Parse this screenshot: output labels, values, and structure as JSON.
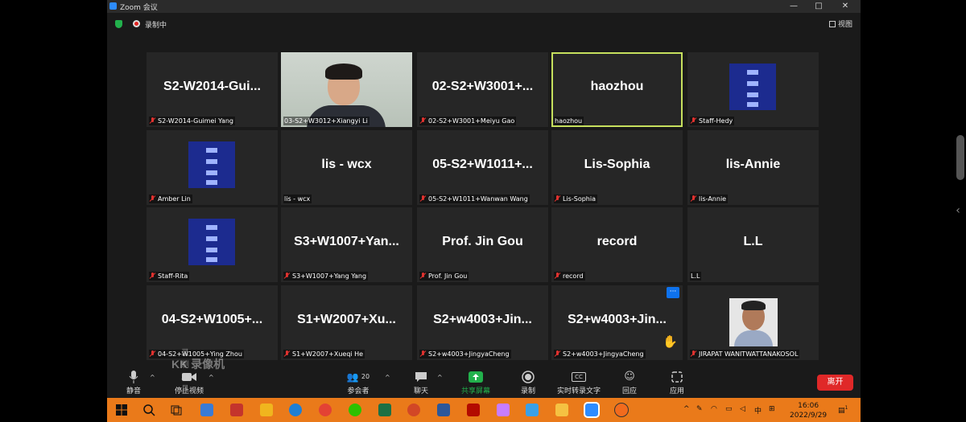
{
  "window": {
    "title": "Zoom 会议",
    "controls": [
      "—",
      "□",
      "✕"
    ]
  },
  "topbar": {
    "recording_label": "录制中",
    "view_label": "视图"
  },
  "tiles": [
    {
      "big": "S2-W2014-Gui...",
      "label": "S2-W2014-Guimei Yang",
      "muted": true,
      "kind": "name"
    },
    {
      "big": "",
      "label": "03-S2+W3012+Xiangyi Li",
      "muted": false,
      "kind": "camera"
    },
    {
      "big": "02-S2+W3001+...",
      "label": "02-S2+W3001+Meiyu Gao",
      "muted": true,
      "kind": "name"
    },
    {
      "big": "haozhou",
      "label": "haozhou",
      "muted": false,
      "kind": "name",
      "active": true
    },
    {
      "big": "",
      "label": "Staff-Hedy",
      "muted": true,
      "kind": "logo"
    },
    {
      "big": "",
      "label": "Amber Lin",
      "muted": true,
      "kind": "logo"
    },
    {
      "big": "lis - wcx",
      "label": "lis - wcx",
      "muted": false,
      "kind": "name"
    },
    {
      "big": "05-S2+W1011+...",
      "label": "05-S2+W1011+Wanwan Wang",
      "muted": true,
      "kind": "name"
    },
    {
      "big": "Lis-Sophia",
      "label": "Lis-Sophia",
      "muted": true,
      "kind": "name"
    },
    {
      "big": "lis-Annie",
      "label": "lis-Annie",
      "muted": true,
      "kind": "name"
    },
    {
      "big": "",
      "label": "Staff-Rita",
      "muted": true,
      "kind": "logo"
    },
    {
      "big": "S3+W1007+Yan...",
      "label": "S3+W1007+Yang Yang",
      "muted": true,
      "kind": "name"
    },
    {
      "big": "Prof. Jin Gou",
      "label": "Prof. Jin Gou",
      "muted": true,
      "kind": "name"
    },
    {
      "big": "record",
      "label": "record",
      "muted": true,
      "kind": "name"
    },
    {
      "big": "L.L",
      "label": "L.L",
      "muted": false,
      "kind": "name"
    },
    {
      "big": "04-S2+W1005+...",
      "label": "04-S2+W1005+Ying Zhou",
      "muted": true,
      "kind": "name"
    },
    {
      "big": "S1+W2007+Xu...",
      "label": "S1+W2007+Xueqi He",
      "muted": true,
      "kind": "name"
    },
    {
      "big": "S2+w4003+Jin...",
      "label": "S2+w4003+JingyaCheng",
      "muted": true,
      "kind": "name"
    },
    {
      "big": "S2+w4003+Jin...",
      "label": "S2+w4003+JingyaCheng",
      "muted": true,
      "kind": "name",
      "more": true
    },
    {
      "big": "",
      "label": "JIRAPAT WANITWATTANAKOSOL",
      "muted": true,
      "kind": "photo"
    }
  ],
  "tile_more_label": "···",
  "watermark": {
    "line1": "录制工具",
    "line2": "KK 录像机"
  },
  "toolbar": {
    "mute": "静音",
    "stop_video": "停止视频",
    "participants": "参会者",
    "participants_count": "20",
    "chat": "聊天",
    "share": "共享屏幕",
    "record": "录制",
    "captions": "实时转录文字",
    "captions_badge": "CC",
    "reactions": "回应",
    "apps": "应用",
    "leave": "离开"
  },
  "taskbar": {
    "time": "16:06",
    "date": "2022/9/29",
    "ime": "中",
    "notification_count": "1"
  },
  "colors": {
    "active_border": "#c6e05d",
    "leave": "#e02828",
    "share_green": "#22b14c",
    "accent_blue": "#0e72ed",
    "taskbar": "#ea7a1a"
  }
}
